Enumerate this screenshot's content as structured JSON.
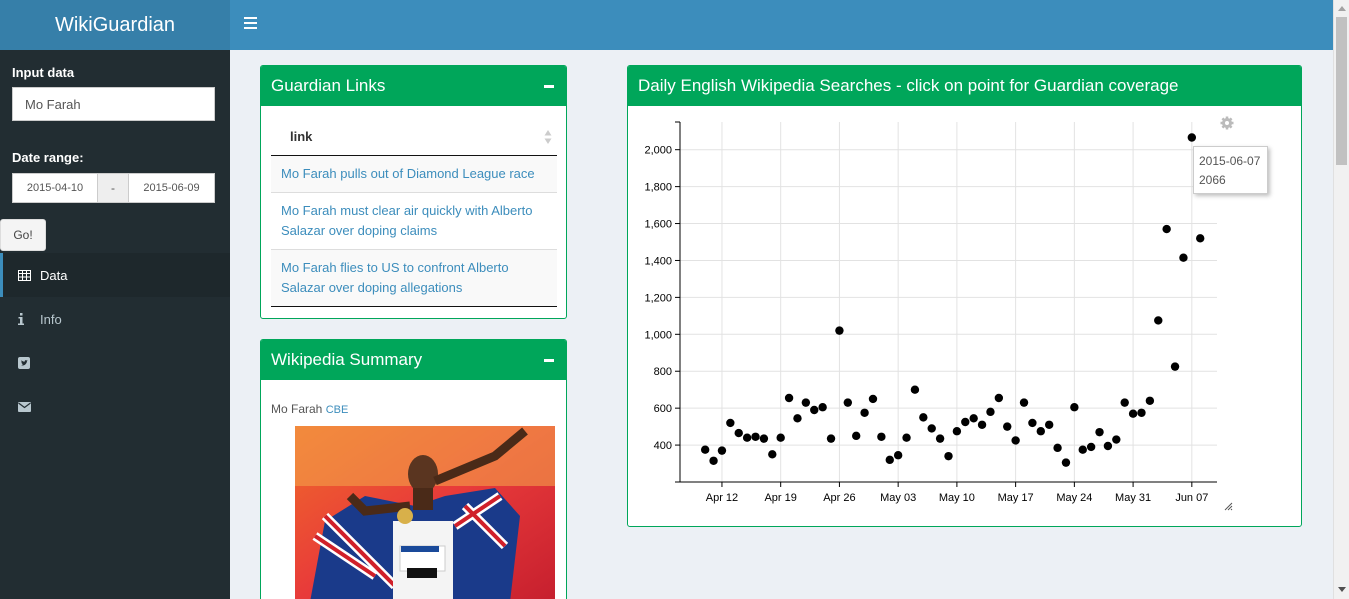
{
  "app": {
    "title": "WikiGuardian"
  },
  "sidebar": {
    "input_label": "Input data",
    "input_value": "Mo Farah",
    "date_label": "Date range:",
    "date_start": "2015-04-10",
    "date_sep": "-",
    "date_end": "2015-06-09",
    "go_label": "Go!",
    "menu": [
      {
        "label": "Data",
        "icon": "table-icon"
      },
      {
        "label": "Info",
        "icon": "info-icon"
      },
      {
        "label": "",
        "icon": "twitter-icon"
      },
      {
        "label": "",
        "icon": "envelope-icon"
      }
    ]
  },
  "links_box": {
    "title": "Guardian Links",
    "column": "link",
    "rows": [
      "Mo Farah pulls out of Diamond League race",
      "Mo Farah must clear air quickly with Alberto Salazar over doping claims",
      "Mo Farah flies to US to confront Alberto Salazar over doping allegations"
    ]
  },
  "summary_box": {
    "title": "Wikipedia Summary",
    "name": "Mo Farah",
    "honour": "CBE"
  },
  "chart_box": {
    "title": "Daily English Wikipedia Searches - click on point for Guardian coverage",
    "tooltip": {
      "date": "2015-06-07",
      "value": "2066"
    }
  },
  "colors": {
    "primary": "#3c8dbc",
    "success": "#00a65a",
    "sidebar": "#222d32"
  },
  "chart_data": {
    "type": "scatter",
    "title": "Daily English Wikipedia Searches - click on point for Guardian coverage",
    "xlabel": "",
    "ylabel": "",
    "x_tick_labels": [
      "Apr 12",
      "Apr 19",
      "Apr 26",
      "May 03",
      "May 10",
      "May 17",
      "May 24",
      "May 31",
      "Jun 07"
    ],
    "x_tick_dates": [
      "2015-04-12",
      "2015-04-19",
      "2015-04-26",
      "2015-05-03",
      "2015-05-10",
      "2015-05-17",
      "2015-05-24",
      "2015-05-31",
      "2015-06-07"
    ],
    "y_ticks": [
      "400",
      "600",
      "800",
      "1,000",
      "1,200",
      "1,400",
      "1,600",
      "1,800",
      "2,000"
    ],
    "y_tick_values": [
      400,
      600,
      800,
      1000,
      1200,
      1400,
      1600,
      1800,
      2000
    ],
    "xlim": [
      "2015-04-07",
      "2015-06-10"
    ],
    "ylim": [
      200,
      2150
    ],
    "grid": true,
    "series": [
      {
        "color": "#000000",
        "x": [
          "2015-04-10",
          "2015-04-11",
          "2015-04-12",
          "2015-04-13",
          "2015-04-14",
          "2015-04-15",
          "2015-04-16",
          "2015-04-17",
          "2015-04-18",
          "2015-04-19",
          "2015-04-20",
          "2015-04-21",
          "2015-04-22",
          "2015-04-23",
          "2015-04-24",
          "2015-04-25",
          "2015-04-26",
          "2015-04-27",
          "2015-04-28",
          "2015-04-29",
          "2015-04-30",
          "2015-05-01",
          "2015-05-02",
          "2015-05-03",
          "2015-05-04",
          "2015-05-05",
          "2015-05-06",
          "2015-05-07",
          "2015-05-08",
          "2015-05-09",
          "2015-05-10",
          "2015-05-11",
          "2015-05-12",
          "2015-05-13",
          "2015-05-14",
          "2015-05-15",
          "2015-05-16",
          "2015-05-17",
          "2015-05-18",
          "2015-05-19",
          "2015-05-20",
          "2015-05-21",
          "2015-05-22",
          "2015-05-23",
          "2015-05-24",
          "2015-05-25",
          "2015-05-26",
          "2015-05-27",
          "2015-05-28",
          "2015-05-29",
          "2015-05-30",
          "2015-05-31",
          "2015-06-01",
          "2015-06-02",
          "2015-06-03",
          "2015-06-04",
          "2015-06-05",
          "2015-06-06",
          "2015-06-07",
          "2015-06-08"
        ],
        "y": [
          375,
          315,
          370,
          520,
          465,
          440,
          445,
          435,
          350,
          440,
          655,
          545,
          630,
          590,
          605,
          435,
          1020,
          630,
          450,
          575,
          650,
          445,
          320,
          345,
          440,
          700,
          550,
          490,
          435,
          340,
          475,
          525,
          545,
          510,
          580,
          655,
          500,
          425,
          630,
          520,
          475,
          510,
          385,
          305,
          605,
          375,
          390,
          470,
          395,
          430,
          630,
          570,
          575,
          640,
          1075,
          1570,
          825,
          1415,
          2066,
          1520
        ]
      }
    ]
  }
}
